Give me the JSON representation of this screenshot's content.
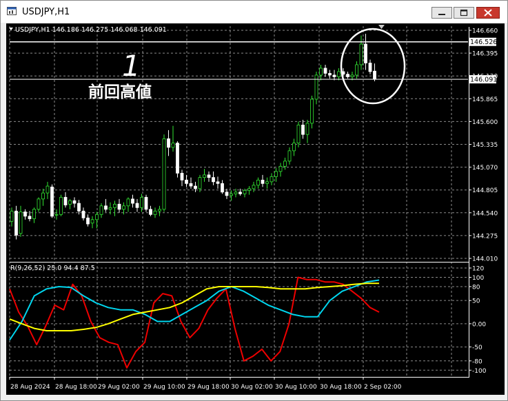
{
  "window": {
    "title": "USDJPY,H1"
  },
  "icons": {
    "app": "chart-window-icon",
    "minimize": "minimize-icon",
    "maximize": "maximize-icon",
    "close": "close-icon"
  },
  "colors": {
    "background": "#000000",
    "grid": "#8c8c8c",
    "bull_candle": "#32e632",
    "bear_candle": "#ffffff",
    "line_red": "#ee0000",
    "line_cyan": "#00d7f0",
    "line_yellow": "#ffff00",
    "text": "#ffffff"
  },
  "price_panel": {
    "header": "USDJPY,H1  146.186 146.275 146.068 146.091",
    "ylim": [
      144.01,
      146.66
    ],
    "y_ticks": [
      "146.660",
      "146.395",
      "146.130",
      "145.865",
      "145.600",
      "145.335",
      "145.070",
      "144.805",
      "144.540",
      "144.275",
      "144.010"
    ],
    "previous_high": {
      "value": 146.526,
      "label": "146.526"
    },
    "current_price": {
      "value": 146.091,
      "label": "146.091"
    },
    "annotation_number": "1",
    "annotation_text": "前回高値"
  },
  "indicator_panel": {
    "header": "R(9,26,52) 25.0 94.4 87.5",
    "ylim": [
      -110,
      120
    ],
    "y_ticks": [
      "120",
      "100",
      "80",
      "50",
      "0.00",
      "-50",
      "-80",
      "-100"
    ]
  },
  "x_axis": {
    "labels": [
      "28 Aug 2024",
      "28 Aug 18:00",
      "29 Aug 02:00",
      "29 Aug 10:00",
      "29 Aug 18:00",
      "30 Aug 02:00",
      "30 Aug 10:00",
      "30 Aug 18:00",
      "2 Sep 02:00"
    ]
  },
  "chart_data": {
    "type": "candlestick",
    "x_labels": [
      "28 Aug 2024",
      "28 Aug 18:00",
      "29 Aug 02:00",
      "29 Aug 10:00",
      "29 Aug 18:00",
      "30 Aug 02:00",
      "30 Aug 10:00",
      "30 Aug 18:00",
      "2 Sep 02:00"
    ],
    "ylim": [
      144.01,
      146.66
    ],
    "candles": [
      [
        144.44,
        144.6,
        144.38,
        144.56
      ],
      [
        144.56,
        144.62,
        144.23,
        144.28
      ],
      [
        144.3,
        144.62,
        144.26,
        144.55
      ],
      [
        144.55,
        144.58,
        144.46,
        144.5
      ],
      [
        144.5,
        144.56,
        144.44,
        144.47
      ],
      [
        144.47,
        144.6,
        144.42,
        144.58
      ],
      [
        144.58,
        144.72,
        144.55,
        144.7
      ],
      [
        144.7,
        144.82,
        144.62,
        144.77
      ],
      [
        144.77,
        144.9,
        144.7,
        144.85
      ],
      [
        144.84,
        144.87,
        144.48,
        144.5
      ],
      [
        144.52,
        144.58,
        144.46,
        144.52
      ],
      [
        144.52,
        144.75,
        144.5,
        144.72
      ],
      [
        144.72,
        144.78,
        144.6,
        144.63
      ],
      [
        144.64,
        144.7,
        144.58,
        144.68
      ],
      [
        144.68,
        144.72,
        144.6,
        144.65
      ],
      [
        144.65,
        144.69,
        144.52,
        144.56
      ],
      [
        144.56,
        144.6,
        144.45,
        144.48
      ],
      [
        144.48,
        144.52,
        144.38,
        144.41
      ],
      [
        144.42,
        144.5,
        144.36,
        144.46
      ],
      [
        144.46,
        144.55,
        144.36,
        144.52
      ],
      [
        144.52,
        144.65,
        144.48,
        144.62
      ],
      [
        144.62,
        144.7,
        144.55,
        144.58
      ],
      [
        144.58,
        144.66,
        144.52,
        144.6
      ],
      [
        144.6,
        144.68,
        144.5,
        144.64
      ],
      [
        144.64,
        144.7,
        144.54,
        144.58
      ],
      [
        144.58,
        144.66,
        144.52,
        144.62
      ],
      [
        144.62,
        144.72,
        144.55,
        144.7
      ],
      [
        144.7,
        144.75,
        144.6,
        144.65
      ],
      [
        144.65,
        144.7,
        144.55,
        144.6
      ],
      [
        144.6,
        144.76,
        144.55,
        144.72
      ],
      [
        144.72,
        144.75,
        144.55,
        144.58
      ],
      [
        144.58,
        144.62,
        144.5,
        144.52
      ],
      [
        144.52,
        144.6,
        144.48,
        144.56
      ],
      [
        144.56,
        144.62,
        144.5,
        144.58
      ],
      [
        144.58,
        145.45,
        144.55,
        145.4
      ],
      [
        145.4,
        145.5,
        145.2,
        145.3
      ],
      [
        145.3,
        145.55,
        145.25,
        145.35
      ],
      [
        145.35,
        145.37,
        144.95,
        145.0
      ],
      [
        145.0,
        145.04,
        144.85,
        144.92
      ],
      [
        144.92,
        144.98,
        144.84,
        144.88
      ],
      [
        144.88,
        144.95,
        144.82,
        144.85
      ],
      [
        144.85,
        144.9,
        144.78,
        144.82
      ],
      [
        144.82,
        144.98,
        144.78,
        144.95
      ],
      [
        144.95,
        145.05,
        144.9,
        144.98
      ],
      [
        144.98,
        145.02,
        144.9,
        144.95
      ],
      [
        144.95,
        145.02,
        144.86,
        144.9
      ],
      [
        144.9,
        144.96,
        144.82,
        144.88
      ],
      [
        144.88,
        144.92,
        144.76,
        144.78
      ],
      [
        144.78,
        144.82,
        144.7,
        144.74
      ],
      [
        144.74,
        144.8,
        144.68,
        144.76
      ],
      [
        144.76,
        144.82,
        144.72,
        144.78
      ],
      [
        144.78,
        144.82,
        144.74,
        144.76
      ],
      [
        144.76,
        144.82,
        144.72,
        144.8
      ],
      [
        144.8,
        144.85,
        144.75,
        144.82
      ],
      [
        144.82,
        144.9,
        144.78,
        144.86
      ],
      [
        144.86,
        144.95,
        144.82,
        144.92
      ],
      [
        144.92,
        144.98,
        144.84,
        144.88
      ],
      [
        144.88,
        144.95,
        144.82,
        144.9
      ],
      [
        144.9,
        145.0,
        144.86,
        144.96
      ],
      [
        144.96,
        145.06,
        144.9,
        145.02
      ],
      [
        145.02,
        145.12,
        144.96,
        145.08
      ],
      [
        145.08,
        145.18,
        145.04,
        145.14
      ],
      [
        145.14,
        145.3,
        145.1,
        145.26
      ],
      [
        145.26,
        145.4,
        145.2,
        145.35
      ],
      [
        145.35,
        145.6,
        145.3,
        145.56
      ],
      [
        145.56,
        145.62,
        145.4,
        145.45
      ],
      [
        145.45,
        145.62,
        145.35,
        145.58
      ],
      [
        145.58,
        145.9,
        145.52,
        145.86
      ],
      [
        145.86,
        146.18,
        145.8,
        146.14
      ],
      [
        146.14,
        146.26,
        146.08,
        146.22
      ],
      [
        146.22,
        146.26,
        146.12,
        146.16
      ],
      [
        146.16,
        146.2,
        146.1,
        146.14
      ],
      [
        146.14,
        146.2,
        146.08,
        146.12
      ],
      [
        146.12,
        146.22,
        146.08,
        146.18
      ],
      [
        146.18,
        146.22,
        146.12,
        146.15
      ],
      [
        146.15,
        146.18,
        146.1,
        146.12
      ],
      [
        146.12,
        146.18,
        146.08,
        146.14
      ],
      [
        146.14,
        146.3,
        146.1,
        146.26
      ],
      [
        146.26,
        146.6,
        146.2,
        146.5
      ],
      [
        146.5,
        146.62,
        146.2,
        146.28
      ],
      [
        146.28,
        146.32,
        146.15,
        146.18
      ],
      [
        146.186,
        146.275,
        146.068,
        146.091
      ]
    ],
    "indicator": {
      "name": "R(9,26,52)",
      "ylim": [
        -110,
        120
      ],
      "series": [
        {
          "name": "R(9)",
          "color": "#ee0000",
          "values": [
            75,
            25,
            -5,
            -45,
            -5,
            40,
            30,
            85,
            60,
            5,
            -30,
            -40,
            -45,
            -95,
            -60,
            -40,
            45,
            65,
            60,
            5,
            -30,
            -10,
            30,
            55,
            75,
            -10,
            -80,
            -70,
            -55,
            -80,
            -60,
            0,
            100,
            95,
            95,
            90,
            90,
            85,
            70,
            55,
            35,
            25
          ]
        },
        {
          "name": "R(26)",
          "color": "#00d7f0",
          "values": [
            -35,
            5,
            60,
            75,
            80,
            78,
            60,
            45,
            35,
            30,
            30,
            20,
            5,
            5,
            20,
            35,
            50,
            70,
            80,
            70,
            55,
            40,
            30,
            20,
            15,
            15,
            50,
            70,
            80,
            90,
            94
          ]
        },
        {
          "name": "R(52)",
          "color": "#ffff00",
          "values": [
            10,
            0,
            -10,
            -15,
            -15,
            -15,
            -12,
            -8,
            0,
            10,
            20,
            25,
            30,
            35,
            45,
            60,
            75,
            80,
            80,
            80,
            80,
            78,
            75,
            75,
            75,
            78,
            80,
            82,
            85,
            87,
            87
          ]
        }
      ]
    }
  }
}
